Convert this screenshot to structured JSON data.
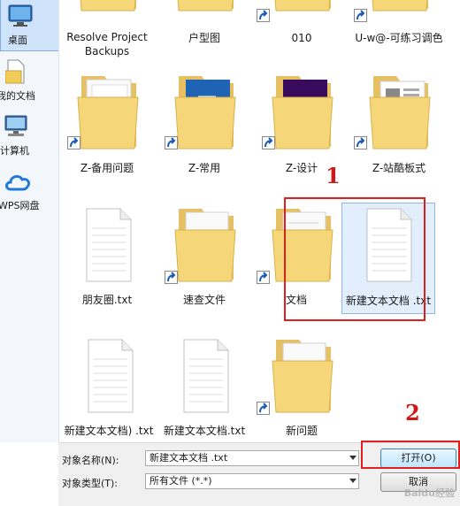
{
  "sidebar": {
    "items": [
      {
        "label": "桌面",
        "icon": "desktop-icon"
      },
      {
        "label": "我的文档",
        "icon": "documents-icon"
      },
      {
        "label": "计算机",
        "icon": "computer-icon"
      },
      {
        "label": "WPS网盘",
        "icon": "cloud-icon"
      }
    ]
  },
  "files": [
    {
      "name": "Resolve Project\nBackups",
      "kind": "folder",
      "icon": "folder-icon",
      "shortcut": false
    },
    {
      "name": "户型图",
      "kind": "folder",
      "icon": "folder-icon",
      "shortcut": false
    },
    {
      "name": "010",
      "kind": "folder-shortcut",
      "icon": "folder-shortcut-icon",
      "shortcut": true
    },
    {
      "name": "U-w@-可练习调色",
      "kind": "folder-shortcut",
      "icon": "folder-shortcut-icon",
      "shortcut": true
    },
    {
      "name": "Z-备用问题",
      "kind": "folder-shortcut",
      "icon": "folder-shortcut-icon",
      "shortcut": true
    },
    {
      "name": "Z-常用",
      "kind": "folder-shortcut",
      "icon": "folder-shortcut-icon",
      "shortcut": true
    },
    {
      "name": "Z-设计",
      "kind": "folder-shortcut",
      "icon": "folder-shortcut-icon",
      "shortcut": true
    },
    {
      "name": "Z-站酷板式",
      "kind": "folder-shortcut",
      "icon": "folder-shortcut-icon",
      "shortcut": true
    },
    {
      "name": "朋友圈.txt",
      "kind": "text-file",
      "icon": "text-file-icon",
      "shortcut": false
    },
    {
      "name": "速查文件",
      "kind": "folder-shortcut",
      "icon": "folder-shortcut-icon",
      "shortcut": true
    },
    {
      "name": "文档",
      "kind": "folder-shortcut",
      "icon": "folder-shortcut-icon",
      "shortcut": true
    },
    {
      "name": "新建文本文档 .txt",
      "kind": "text-file",
      "icon": "text-file-icon",
      "shortcut": false,
      "selected": true
    },
    {
      "name": "新建文本文档) .txt",
      "kind": "text-file",
      "icon": "text-file-icon",
      "shortcut": false
    },
    {
      "name": "新建文本文档.txt",
      "kind": "text-file",
      "icon": "text-file-icon",
      "shortcut": false
    },
    {
      "name": "新问题",
      "kind": "folder-shortcut",
      "icon": "folder-shortcut-icon",
      "shortcut": true
    }
  ],
  "footer": {
    "name_label": "对象名称(N):",
    "name_value": "新建文本文档 .txt",
    "type_label": "对象类型(T):",
    "type_value": "所有文件 (*.*)",
    "open_button": "打开(O)",
    "cancel_button": "取消"
  },
  "annotations": {
    "marker_1": "1",
    "marker_2": "2",
    "color": "#e02020"
  },
  "watermark": "Baidu经验"
}
